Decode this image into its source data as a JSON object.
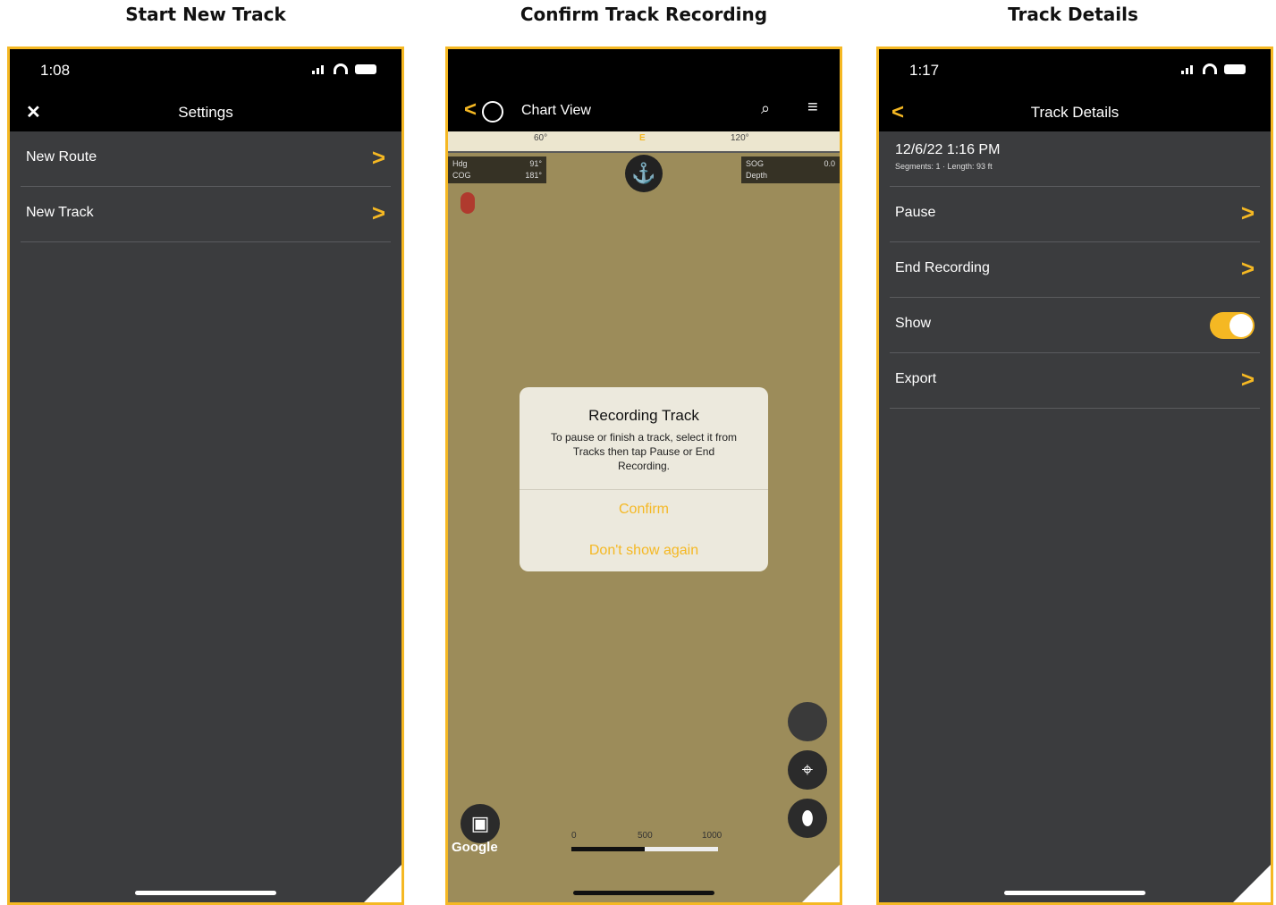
{
  "captions": [
    "Start New Track",
    "Confirm Track Recording",
    "Track Details"
  ],
  "screen1": {
    "time": "1:08",
    "title": "Settings",
    "close_icon": "close-icon",
    "rows": [
      {
        "label": "New Route",
        "chevron": ">"
      },
      {
        "label": "New Track",
        "chevron": ">"
      }
    ]
  },
  "screen2": {
    "title": "Chart View",
    "back_icon": "chevron-left-icon",
    "compass_icon": "compass-icon",
    "search_icon": "search-icon",
    "menu_icon": "menu-icon",
    "ruler": {
      "ticks": [
        "60°",
        "E",
        "120°"
      ]
    },
    "left_box": {
      "row1_label": "Hdg",
      "row1_value": "91°",
      "row2_label": "COG",
      "row2_value": "181°"
    },
    "right_box": {
      "row1_label": "SOG",
      "row1_value": "0.0",
      "row2_label": "Depth",
      "row2_value": ""
    },
    "anchor_icon": "anchor-icon",
    "dialog": {
      "title": "Recording Track",
      "message": "To pause or finish a track, select it from Tracks then tap Pause or End Recording.",
      "confirm": "Confirm",
      "dont_show": "Don't show again"
    },
    "scale_labels": [
      "0",
      "500",
      "1000"
    ],
    "google": "Google"
  },
  "screen3": {
    "time": "1:17",
    "title": "Track Details",
    "track_title": "12/6/22 1:16 PM",
    "track_sub": "Segments: 1 · Length: 93 ft",
    "rows": [
      {
        "label": "Pause",
        "chevron": ">"
      },
      {
        "label": "End Recording",
        "chevron": ">"
      },
      {
        "label": "Show",
        "toggle": true
      },
      {
        "label": "Export",
        "chevron": ">"
      }
    ]
  },
  "colors": {
    "accent": "#f5b823",
    "panel": "#3b3c3e",
    "map": "#9c8c5a"
  }
}
